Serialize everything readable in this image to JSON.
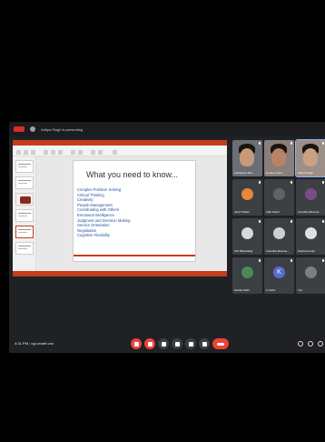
{
  "meeting": {
    "title": "Aditya Singh is presenting",
    "time": "4:31 PM",
    "meeting_code": "ngr-enaet-vrw"
  },
  "presentation": {
    "slide_title": "What you need to know...",
    "skills": [
      "Complex Problem Solving",
      "Critical Thinking",
      "Creativity",
      "People Management",
      "Coordinating with Others",
      "Emotional Intelligence",
      "Judgment and Decision Making",
      "Service Orientation",
      "Negotiation",
      "Cognitive Flexibility"
    ]
  },
  "participants": [
    {
      "name": "Aishwarya Jha..."
    },
    {
      "name": "Gurleen Kaur..."
    },
    {
      "name": "Aditya Singh"
    },
    {
      "name": "Janvi Thakur"
    },
    {
      "name": "Aditi Tiwari"
    },
    {
      "name": "Anushka Sharma..."
    },
    {
      "name": "Kirti Bharadwaj"
    },
    {
      "name": "Anamika Sharma..."
    },
    {
      "name": "Sneha Kumari"
    },
    {
      "name": "Kanika Sethi"
    },
    {
      "name": "K Vishu",
      "initial": "K"
    },
    {
      "name": "You"
    }
  ],
  "colors": {
    "background": "#202124",
    "powerpoint": "#c43e1c",
    "skill_text": "#1f4e9e",
    "end_call": "#ea4335"
  }
}
